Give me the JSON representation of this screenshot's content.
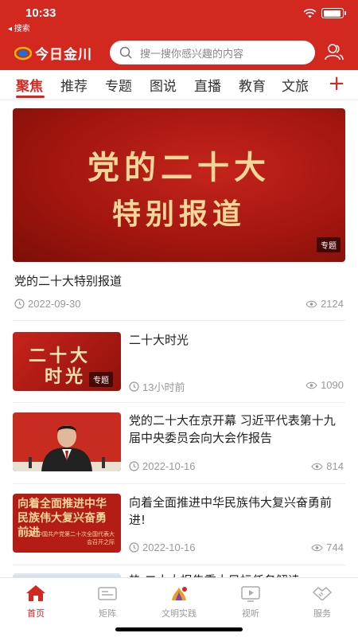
{
  "status_bar": {
    "time": "10:33",
    "back_label": "◂ 搜索"
  },
  "header": {
    "logo_text": "今日金川",
    "search_placeholder": "搜一搜你感兴趣的内容"
  },
  "tabs": [
    {
      "label": "聚焦",
      "active": true
    },
    {
      "label": "推荐"
    },
    {
      "label": "专题"
    },
    {
      "label": "图说"
    },
    {
      "label": "直播"
    },
    {
      "label": "教育"
    },
    {
      "label": "文旅"
    }
  ],
  "tab_add": "+",
  "hero": {
    "image_line1": "党的二十大",
    "image_line2": "特别报道",
    "badge": "专题",
    "title": "党的二十大特别报道",
    "date": "2022-09-30",
    "views": "2124"
  },
  "items": [
    {
      "thumb_line1": "二十大",
      "thumb_line2": "时光",
      "badge": "专题",
      "title": "二十大时光",
      "date": "13小时前",
      "views": "1090"
    },
    {
      "title": "党的二十大在京开幕 习近平代表第十九届中央委员会向大会作报告",
      "date": "2022-10-16",
      "views": "814"
    },
    {
      "thumb_big": "向着全面推进中华民族伟大复兴奋勇前进",
      "thumb_small": "写在中国共产党第二十次全国代表大会召开之际",
      "title": "向着全面推进中华民族伟大复兴奋勇前进!",
      "date": "2022-10-16",
      "views": "744"
    }
  ],
  "partial_item_title": "热·二十大报告重大目标任务解读",
  "bottom_nav": [
    {
      "label": "首页",
      "active": true
    },
    {
      "label": "矩阵"
    },
    {
      "label": "文明实践"
    },
    {
      "label": "视听"
    },
    {
      "label": "服务"
    }
  ],
  "colors": {
    "brand_red": "#d32820",
    "gold_text": "#f3d79a"
  }
}
